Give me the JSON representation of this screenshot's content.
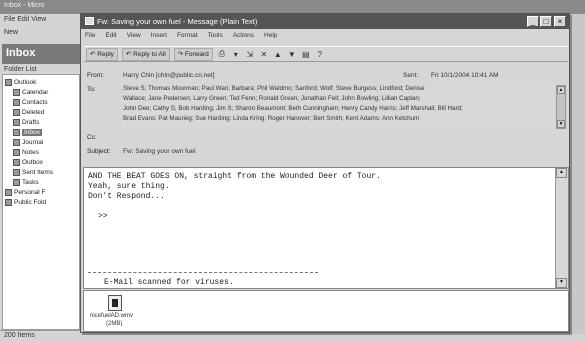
{
  "background_window": {
    "title": "Inbox - Micro",
    "menu": "File  Edit  View",
    "toolbar": "New",
    "inbox_label": "Inbox",
    "folder_list_label": "Folder List",
    "tree": [
      {
        "label": "Outlook",
        "selected": false
      },
      {
        "label": "Calendar",
        "selected": false
      },
      {
        "label": "Contacts",
        "selected": false
      },
      {
        "label": "Deleted",
        "selected": false
      },
      {
        "label": "Drafts",
        "selected": false
      },
      {
        "label": "Inbox",
        "selected": true
      },
      {
        "label": "Journal",
        "selected": false
      },
      {
        "label": "Notes",
        "selected": false
      },
      {
        "label": "Outbox",
        "selected": false
      },
      {
        "label": "Sent Items",
        "selected": false
      },
      {
        "label": "Tasks",
        "selected": false
      },
      {
        "label": "Personal F",
        "selected": false
      },
      {
        "label": "Public Fold",
        "selected": false
      }
    ],
    "status": "200 Items"
  },
  "message_window": {
    "title": "Fw: Saving your own fuel - Message (Plain Text)",
    "menu": [
      "File",
      "Edit",
      "View",
      "Insert",
      "Format",
      "Tools",
      "Actions",
      "Help"
    ],
    "toolbar": {
      "reply": "Reply",
      "reply_all": "Reply to All",
      "forward": "Forward"
    },
    "header": {
      "from_label": "From:",
      "from_value": "Harry Chin [chin@public.cn.net]",
      "sent_label": "Sent:",
      "sent_value": "Fri 10/1/2004 10:41 AM",
      "to_label": "To:",
      "to_lines": [
        "Steve S; Thomas Moorman; Paul Wan; Barbara; Phil Waldmo; Sanford; Wolf; Steve Burgess; Lindford; Denise",
        "Wallace; Jane Pedersen; Larry Green; Ted Fenn; Ronald Green; Jonathan Fell; John Bowling; Lillian Caplan;",
        "John Dee; Cathy S; Bob Harding; Jim S; Sharon Beaumont; Beth Cunningham; Henry Candy Harris; Jeff Marshall; Bill Hard;",
        "Brad Evans; Pat Maurieg; Sue Harding; Linda Kring; Roger Hanover; Bert Smith; Kent Adams; Ann Ketchum"
      ],
      "cc_label": "Cc:",
      "subject_label": "Subject:",
      "subject_value": "Fw: Saving your own fuel"
    },
    "body_lines": [
      "AND THE BEAT GOES ON, straight from the Wounded Deer of Tour.",
      "Yeah, sure thing.",
      "Don't Respond...",
      "",
      ">>"
    ],
    "scanned_note": "E-Mail scanned for viruses.",
    "attachment": {
      "name": "nicefuelAD.wmv",
      "size": "(2MB)"
    }
  }
}
